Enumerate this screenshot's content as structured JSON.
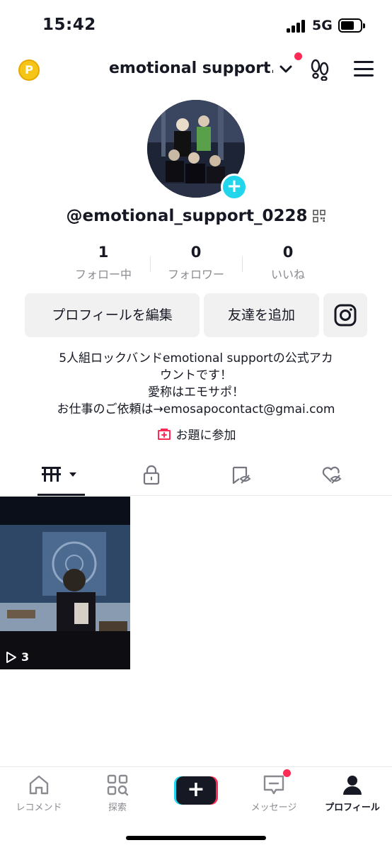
{
  "status_bar": {
    "time": "15:42",
    "network": "5G"
  },
  "header": {
    "account_name": "emotional support...",
    "coin_symbol": "P"
  },
  "profile": {
    "username": "@emotional_support_0228",
    "avatar_plus": "+",
    "stats": [
      {
        "value": "1",
        "label": "フォロー中"
      },
      {
        "value": "0",
        "label": "フォロワー"
      },
      {
        "value": "0",
        "label": "いいね"
      }
    ],
    "buttons": {
      "edit": "プロフィールを編集",
      "add_friend": "友達を追加"
    },
    "bio_lines": [
      "5人組ロックバンドemotional supportの公式アカ",
      "ウントです！",
      "愛称はエモサポ！",
      "お仕事のご依頼は→emosapocontact@gmai.com"
    ],
    "challenge_label": "お題に参加"
  },
  "videos": [
    {
      "play_count": "3"
    }
  ],
  "bottom_nav": {
    "items": [
      {
        "label": "レコメンド"
      },
      {
        "label": "探索"
      },
      {
        "label": "メッセージ"
      },
      {
        "label": "プロフィール"
      }
    ],
    "create_plus": "+"
  },
  "colors": {
    "accent": "#fe2c55",
    "cyan": "#20d5ec",
    "text": "#161823",
    "muted": "#8a8b91"
  }
}
